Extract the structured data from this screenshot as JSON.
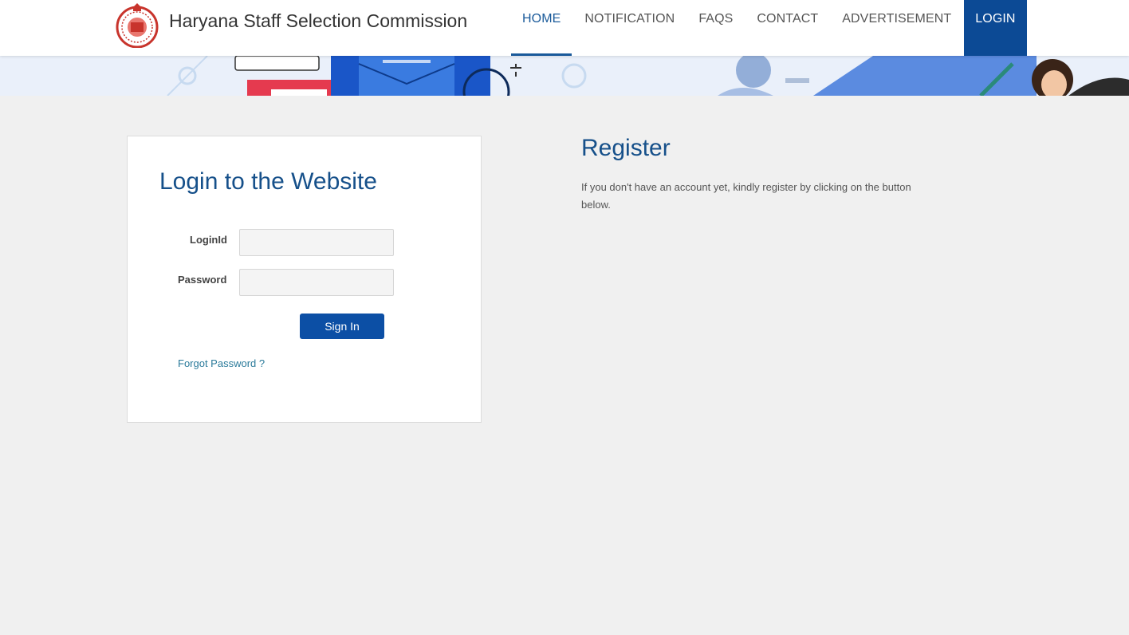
{
  "site": {
    "title": "Haryana Staff Selection Commission",
    "logo_icon": "state-emblem-seal-icon"
  },
  "nav": {
    "items": [
      {
        "label": "HOME",
        "active": true
      },
      {
        "label": "NOTIFICATION",
        "active": false
      },
      {
        "label": "FAQS",
        "active": false
      },
      {
        "label": "CONTACT",
        "active": false
      },
      {
        "label": "ADVERTISEMENT",
        "active": false
      },
      {
        "label": "LOGIN",
        "active": false
      }
    ]
  },
  "login": {
    "title": "Login to the Website",
    "loginid_label": "LoginId",
    "loginid_value": "",
    "password_label": "Password",
    "password_value": "",
    "signin_label": "Sign In",
    "forgot_label": "Forgot Password ?"
  },
  "register": {
    "title": "Register",
    "text": "If you don't have an account yet, kindly register by clicking on the button below."
  },
  "colors": {
    "primary": "#0c4a95",
    "heading": "#16508a",
    "link": "#2a7a9a",
    "background": "#f0f0f0"
  }
}
